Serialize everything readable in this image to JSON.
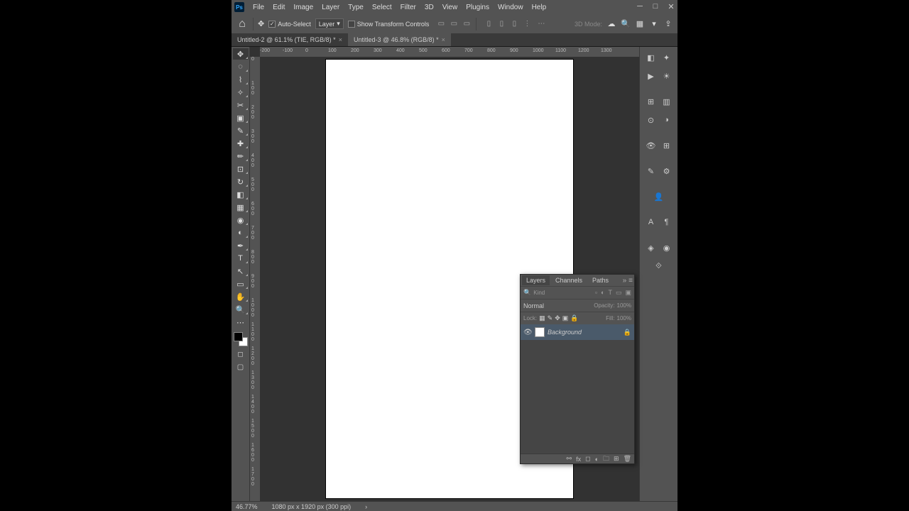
{
  "app_name": "Ps",
  "menubar": [
    "File",
    "Edit",
    "Image",
    "Layer",
    "Type",
    "Select",
    "Filter",
    "3D",
    "View",
    "Plugins",
    "Window",
    "Help"
  ],
  "optionsbar": {
    "auto_select_label": "Auto-Select",
    "auto_select_checked": true,
    "target": "Layer",
    "show_transform_label": "Show Transform Controls",
    "show_transform_checked": false,
    "mode3d": "3D Mode:"
  },
  "tabs": [
    {
      "label": "Untitled-2 @ 61.1% (TIE, RGB/8) *",
      "active": false
    },
    {
      "label": "Untitled-3 @ 46.8% (RGB/8) *",
      "active": true
    }
  ],
  "ruler_h": [
    "-200",
    "-100",
    "0",
    "100",
    "200",
    "300",
    "400",
    "500",
    "600",
    "700",
    "800",
    "900",
    "1000",
    "1100",
    "1200",
    "1300"
  ],
  "ruler_v": [
    "0",
    "100",
    "200",
    "300",
    "400",
    "500",
    "600",
    "700",
    "800",
    "900",
    "1000",
    "1100",
    "1200",
    "1300",
    "1400",
    "1500",
    "1600",
    "1700"
  ],
  "layers_panel": {
    "tabs": [
      "Layers",
      "Channels",
      "Paths"
    ],
    "active_tab": "Layers",
    "filter_kind": "Kind",
    "blend_mode": "Normal",
    "opacity_label": "Opacity:",
    "opacity_value": "100%",
    "lock_label": "Lock:",
    "fill_label": "Fill:",
    "fill_value": "100%",
    "layers": [
      {
        "name": "Background",
        "locked": true,
        "visible": true
      }
    ]
  },
  "statusbar": {
    "zoom": "46.77%",
    "docinfo": "1080 px x 1920 px (300 ppi)"
  }
}
